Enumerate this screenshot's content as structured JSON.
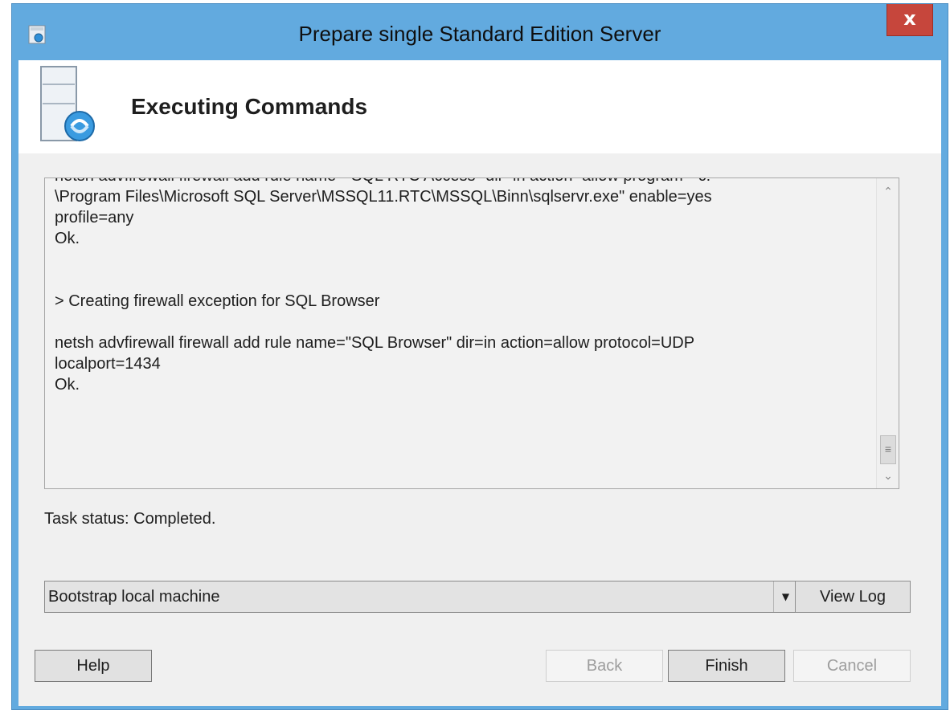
{
  "window": {
    "title": "Prepare single Standard Edition Server",
    "close_label": "x"
  },
  "header": {
    "title": "Executing Commands"
  },
  "log": {
    "lines": [
      "netsh advfirewall firewall add rule name=\"SQL RTC Access\" dir=in action=allow program=\"c:",
      "\\Program Files\\Microsoft SQL Server\\MSSQL11.RTC\\MSSQL\\Binn\\sqlservr.exe\" enable=yes",
      "profile=any",
      "Ok.",
      "",
      "",
      "> Creating firewall exception for SQL Browser",
      "",
      "netsh advfirewall firewall add rule name=\"SQL Browser\" dir=in action=allow protocol=UDP",
      "localport=1434",
      "Ok."
    ]
  },
  "status": {
    "text": "Task status: Completed."
  },
  "task_select": {
    "value": "Bootstrap local machine"
  },
  "buttons": {
    "view_log": "View Log",
    "help": "Help",
    "back": "Back",
    "finish": "Finish",
    "cancel": "Cancel"
  },
  "colors": {
    "window_frame": "#62aadf",
    "close_button": "#c6463c",
    "client_background": "#f0f0f0"
  }
}
